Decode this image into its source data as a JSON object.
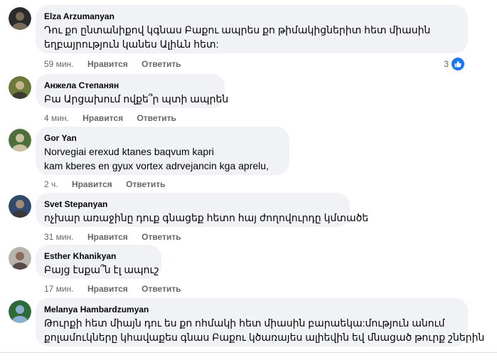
{
  "comments": [
    {
      "author": "Elza Arzumanyan",
      "lines": [
        "Դու քո ընտանիքով կգնաս Բաքու ապրես քո թիմակիցներիտ հետ միասին",
        "եղբայրություն կանես Ալիևն հետ:"
      ],
      "time": "59 мин.",
      "like": "Нравится",
      "reply": "Ответить",
      "reaction_count": "3",
      "avatar_colors": [
        "#2b2b2b",
        "#7a6a58"
      ]
    },
    {
      "author": "Анжела Степанян",
      "lines": [
        "Բա Արցախում ովքե՞ր պտի ապրեն"
      ],
      "time": "4 мин.",
      "like": "Нравится",
      "reply": "Ответить",
      "avatar_colors": [
        "#6b7a3a",
        "#c7b48a"
      ]
    },
    {
      "author": "Gor Yan",
      "lines": [
        "Norvegiai erexud ktanes baqvum kapri",
        "kam kberes en gyux vortex adrvejancin kga aprelu,"
      ],
      "time": "2 ч.",
      "like": "Нравится",
      "reply": "Ответить",
      "avatar_colors": [
        "#4f6f3a",
        "#c9c2a0"
      ]
    },
    {
      "author": "Svet Stepanyan",
      "lines": [
        "ոչխար առաջինը դուք գնացեք հետո հայ ժողովուրդը կմտածե"
      ],
      "time": "31 мин.",
      "like": "Нравится",
      "reply": "Ответить",
      "avatar_colors": [
        "#2f4a6a",
        "#3a3a3a"
      ]
    },
    {
      "author": "Esther Khanikyan",
      "lines": [
        "Բայց էսքա՞ն էլ ապուշ"
      ],
      "time": "17 мин.",
      "like": "Нравится",
      "reply": "Ответить",
      "avatar_colors": [
        "#b9b3ad",
        "#5a4a4a"
      ]
    },
    {
      "author": "Melanya Hambardzumyan",
      "lines": [
        "Թուրքի հետ միայն դու ես քո ոհմակի հետ միասին բարաեկա:մություն անում",
        "քոլամուկները կհավաքես գնաս Բաքու կծառայես ալիեվին եվ մնացած թուրք շներին"
      ],
      "avatar_colors": [
        "#2f6a3a",
        "#8ab0d0"
      ]
    }
  ]
}
